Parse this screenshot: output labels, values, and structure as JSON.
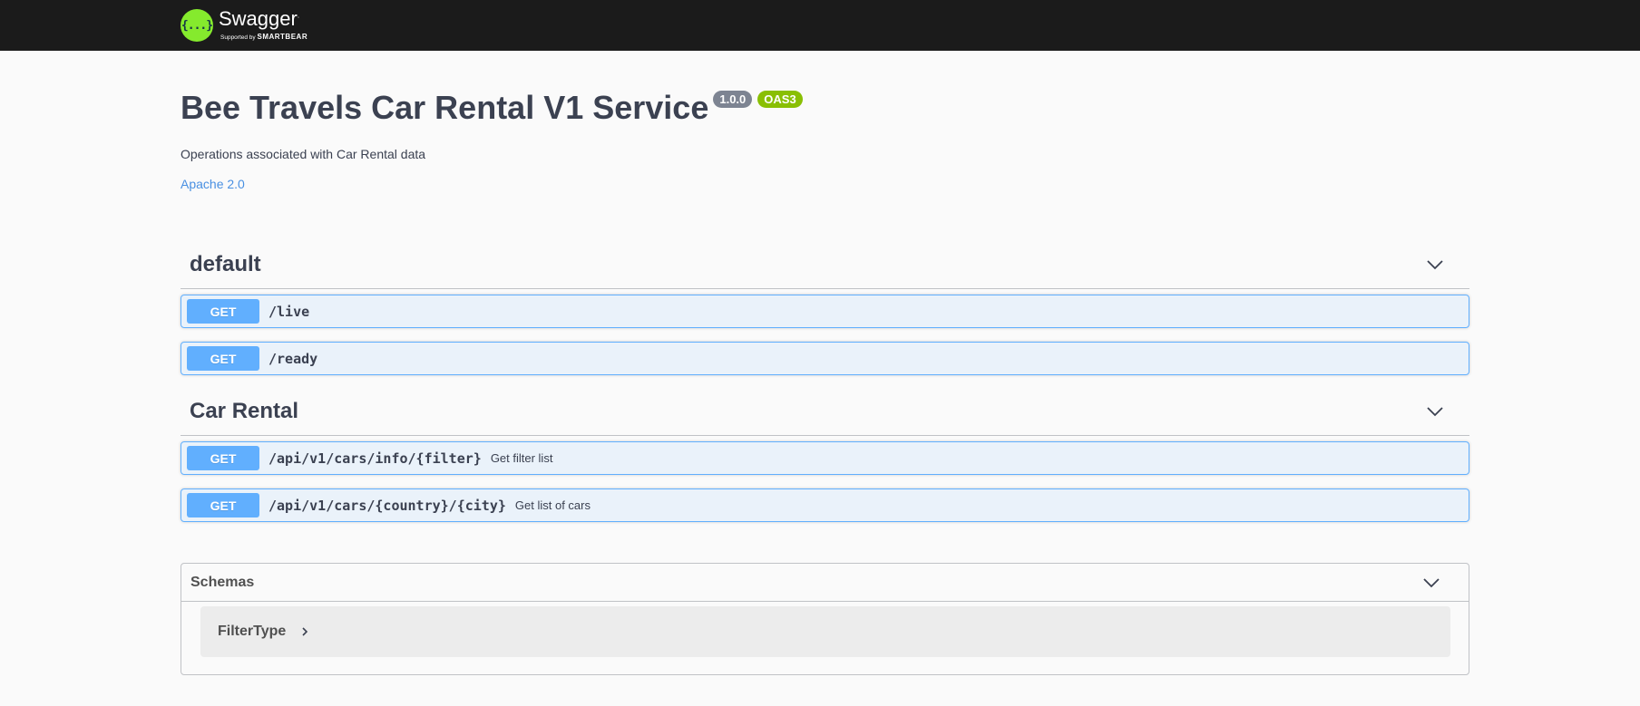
{
  "topbar": {
    "logo_mark": "{...}",
    "brand": "Swagger",
    "supported_prefix": "Supported by",
    "supported_by": "SMARTBEAR"
  },
  "info": {
    "title": "Bee Travels Car Rental V1 Service",
    "version": "1.0.0",
    "oas_badge": "OAS3",
    "description": "Operations associated with Car Rental data",
    "license": "Apache 2.0"
  },
  "tags": [
    {
      "name": "default",
      "operations": [
        {
          "method": "GET",
          "path": "/live",
          "summary": ""
        },
        {
          "method": "GET",
          "path": "/ready",
          "summary": ""
        }
      ]
    },
    {
      "name": "Car Rental",
      "operations": [
        {
          "method": "GET",
          "path": "/api/v1/cars/info/{filter}",
          "summary": "Get filter list"
        },
        {
          "method": "GET",
          "path": "/api/v1/cars/{country}/{city}",
          "summary": "Get list of cars"
        }
      ]
    }
  ],
  "schemas": {
    "title": "Schemas",
    "items": [
      "FilterType"
    ]
  },
  "icons": {
    "chevron": "chevron-down-icon",
    "expand": "chevron-right-icon"
  },
  "colors": {
    "topbar": "#1b1b1b",
    "logo": "#85ea2d",
    "get": "#61affe",
    "version_badge": "#7d8492",
    "oas_badge": "#89bf04",
    "link": "#4990e2"
  }
}
